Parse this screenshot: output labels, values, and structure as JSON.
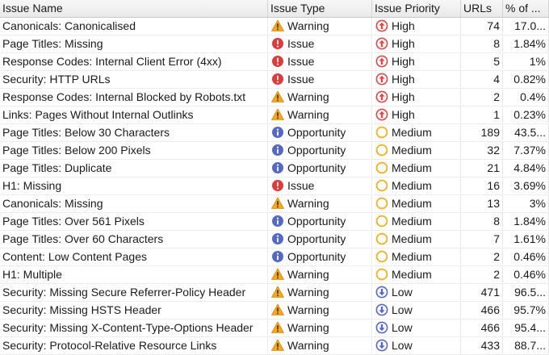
{
  "table": {
    "columns": [
      "Issue Name",
      "Issue Type",
      "Issue Priority",
      "URLs",
      "% of ..."
    ],
    "rows": [
      {
        "name": "Canonicals: Canonicalised",
        "type": "Warning",
        "type_icon": "warning-icon",
        "priority": "High",
        "priority_icon": "high-priority-icon",
        "urls": "74",
        "pct": "17.0..."
      },
      {
        "name": "Page Titles: Missing",
        "type": "Issue",
        "type_icon": "issue-icon",
        "priority": "High",
        "priority_icon": "high-priority-icon",
        "urls": "8",
        "pct": "1.84%"
      },
      {
        "name": "Response Codes: Internal Client Error (4xx)",
        "type": "Issue",
        "type_icon": "issue-icon",
        "priority": "High",
        "priority_icon": "high-priority-icon",
        "urls": "5",
        "pct": "1%"
      },
      {
        "name": "Security: HTTP URLs",
        "type": "Issue",
        "type_icon": "issue-icon",
        "priority": "High",
        "priority_icon": "high-priority-icon",
        "urls": "4",
        "pct": "0.82%"
      },
      {
        "name": "Response Codes: Internal Blocked by Robots.txt",
        "type": "Warning",
        "type_icon": "warning-icon",
        "priority": "High",
        "priority_icon": "high-priority-icon",
        "urls": "2",
        "pct": "0.4%"
      },
      {
        "name": "Links: Pages Without Internal Outlinks",
        "type": "Warning",
        "type_icon": "warning-icon",
        "priority": "High",
        "priority_icon": "high-priority-icon",
        "urls": "1",
        "pct": "0.23%"
      },
      {
        "name": "Page Titles: Below 30 Characters",
        "type": "Opportunity",
        "type_icon": "opportunity-icon",
        "priority": "Medium",
        "priority_icon": "medium-priority-icon",
        "urls": "189",
        "pct": "43.5..."
      },
      {
        "name": "Page Titles: Below 200 Pixels",
        "type": "Opportunity",
        "type_icon": "opportunity-icon",
        "priority": "Medium",
        "priority_icon": "medium-priority-icon",
        "urls": "32",
        "pct": "7.37%"
      },
      {
        "name": "Page Titles: Duplicate",
        "type": "Opportunity",
        "type_icon": "opportunity-icon",
        "priority": "Medium",
        "priority_icon": "medium-priority-icon",
        "urls": "21",
        "pct": "4.84%"
      },
      {
        "name": "H1: Missing",
        "type": "Issue",
        "type_icon": "issue-icon",
        "priority": "Medium",
        "priority_icon": "medium-priority-icon",
        "urls": "16",
        "pct": "3.69%"
      },
      {
        "name": "Canonicals: Missing",
        "type": "Warning",
        "type_icon": "warning-icon",
        "priority": "Medium",
        "priority_icon": "medium-priority-icon",
        "urls": "13",
        "pct": "3%"
      },
      {
        "name": "Page Titles: Over 561 Pixels",
        "type": "Opportunity",
        "type_icon": "opportunity-icon",
        "priority": "Medium",
        "priority_icon": "medium-priority-icon",
        "urls": "8",
        "pct": "1.84%"
      },
      {
        "name": "Page Titles: Over 60 Characters",
        "type": "Opportunity",
        "type_icon": "opportunity-icon",
        "priority": "Medium",
        "priority_icon": "medium-priority-icon",
        "urls": "7",
        "pct": "1.61%"
      },
      {
        "name": "Content: Low Content Pages",
        "type": "Opportunity",
        "type_icon": "opportunity-icon",
        "priority": "Medium",
        "priority_icon": "medium-priority-icon",
        "urls": "2",
        "pct": "0.46%"
      },
      {
        "name": "H1: Multiple",
        "type": "Warning",
        "type_icon": "warning-icon",
        "priority": "Medium",
        "priority_icon": "medium-priority-icon",
        "urls": "2",
        "pct": "0.46%"
      },
      {
        "name": "Security: Missing Secure Referrer-Policy Header",
        "type": "Warning",
        "type_icon": "warning-icon",
        "priority": "Low",
        "priority_icon": "low-priority-icon",
        "urls": "471",
        "pct": "96.5..."
      },
      {
        "name": "Security: Missing HSTS Header",
        "type": "Warning",
        "type_icon": "warning-icon",
        "priority": "Low",
        "priority_icon": "low-priority-icon",
        "urls": "466",
        "pct": "95.7%"
      },
      {
        "name": "Security: Missing X-Content-Type-Options Header",
        "type": "Warning",
        "type_icon": "warning-icon",
        "priority": "Low",
        "priority_icon": "low-priority-icon",
        "urls": "466",
        "pct": "95.4..."
      },
      {
        "name": "Security: Protocol-Relative Resource Links",
        "type": "Warning",
        "type_icon": "warning-icon",
        "priority": "Low",
        "priority_icon": "low-priority-icon",
        "urls": "433",
        "pct": "88.7..."
      }
    ]
  },
  "colors": {
    "warning": "#f5a623",
    "issue": "#e03a3a",
    "opportunity": "#5468c8",
    "high": "#e04848",
    "medium": "#f2b01e",
    "low": "#5468c8"
  }
}
